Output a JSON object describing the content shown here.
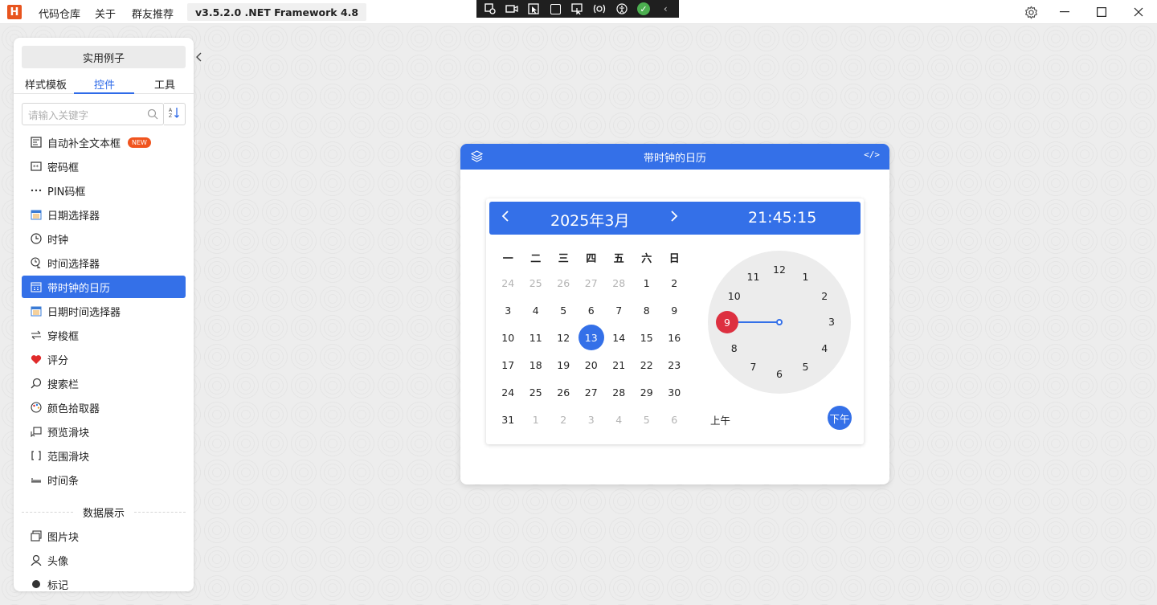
{
  "titlebar": {
    "logo": "H",
    "menu": [
      "代码仓库",
      "关于",
      "群友推荐"
    ],
    "version": "v3.5.2.0 .NET Framework 4.8"
  },
  "sidebar": {
    "examples_button": "实用例子",
    "tabs": [
      "样式模板",
      "控件",
      "工具"
    ],
    "active_tab": "控件",
    "search_placeholder": "请输入关键字",
    "items": [
      {
        "label": "自动补全文本框",
        "icon": "autocomplete-icon",
        "badge": "NEW"
      },
      {
        "label": "密码框",
        "icon": "password-icon"
      },
      {
        "label": "PIN码框",
        "icon": "pin-icon"
      },
      {
        "label": "日期选择器",
        "icon": "calendar-icon"
      },
      {
        "label": "时钟",
        "icon": "clock-icon"
      },
      {
        "label": "时间选择器",
        "icon": "time-picker-icon"
      },
      {
        "label": "带时钟的日历",
        "icon": "calendar-clock-icon",
        "active": true
      },
      {
        "label": "日期时间选择器",
        "icon": "datetime-icon"
      },
      {
        "label": "穿梭框",
        "icon": "transfer-icon"
      },
      {
        "label": "评分",
        "icon": "heart-icon"
      },
      {
        "label": "搜索栏",
        "icon": "search-icon"
      },
      {
        "label": "颜色拾取器",
        "icon": "palette-icon"
      },
      {
        "label": "预览滑块",
        "icon": "preview-slider-icon"
      },
      {
        "label": "范围滑块",
        "icon": "range-slider-icon"
      },
      {
        "label": "时间条",
        "icon": "timebar-icon"
      }
    ],
    "section_title": "数据展示",
    "items2": [
      {
        "label": "图片块",
        "icon": "image-block-icon"
      },
      {
        "label": "头像",
        "icon": "avatar-icon"
      },
      {
        "label": "标记",
        "icon": "badge-icon"
      }
    ]
  },
  "demo": {
    "title": "带时钟的日历",
    "code_icon": "</>",
    "calendar": {
      "month_label": "2025年3月",
      "time": "21:45:15",
      "weekdays": [
        "一",
        "二",
        "三",
        "四",
        "五",
        "六",
        "日"
      ],
      "weeks": [
        [
          [
            "24",
            1
          ],
          [
            "25",
            1
          ],
          [
            "26",
            1
          ],
          [
            "27",
            1
          ],
          [
            "28",
            1
          ],
          [
            "1",
            0
          ],
          [
            "2",
            0
          ]
        ],
        [
          [
            "3",
            0
          ],
          [
            "4",
            0
          ],
          [
            "5",
            0
          ],
          [
            "6",
            0
          ],
          [
            "7",
            0
          ],
          [
            "8",
            0
          ],
          [
            "9",
            0
          ]
        ],
        [
          [
            "10",
            0
          ],
          [
            "11",
            0
          ],
          [
            "12",
            0
          ],
          [
            "13",
            2
          ],
          [
            "14",
            0
          ],
          [
            "15",
            0
          ],
          [
            "16",
            0
          ]
        ],
        [
          [
            "17",
            0
          ],
          [
            "18",
            0
          ],
          [
            "19",
            0
          ],
          [
            "20",
            0
          ],
          [
            "21",
            0
          ],
          [
            "22",
            0
          ],
          [
            "23",
            0
          ]
        ],
        [
          [
            "24",
            0
          ],
          [
            "25",
            0
          ],
          [
            "26",
            0
          ],
          [
            "27",
            0
          ],
          [
            "28",
            0
          ],
          [
            "29",
            0
          ],
          [
            "30",
            0
          ]
        ],
        [
          [
            "31",
            0
          ],
          [
            "1",
            1
          ],
          [
            "2",
            1
          ],
          [
            "3",
            1
          ],
          [
            "4",
            1
          ],
          [
            "5",
            1
          ],
          [
            "6",
            1
          ]
        ]
      ],
      "selected_day": "13",
      "clock_numbers": [
        "12",
        "1",
        "2",
        "3",
        "4",
        "5",
        "6",
        "7",
        "8",
        "9",
        "10",
        "11"
      ],
      "selected_hour": "9",
      "am_label": "上午",
      "pm_label": "下午",
      "accent_color": "#3470e8",
      "hour_select_color": "#dd3040"
    }
  }
}
